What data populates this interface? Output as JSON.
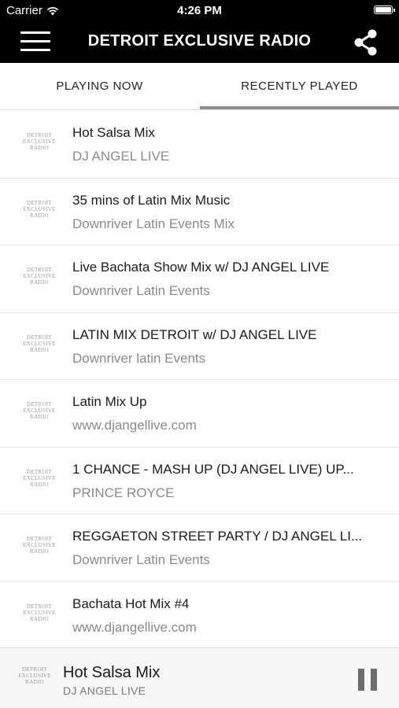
{
  "status_bar": {
    "carrier": "Carrier",
    "time": "4:26 PM"
  },
  "header": {
    "title": "DETROIT EXCLUSIVE RADIO",
    "menu_icon": "hamburger-menu-icon",
    "share_icon": "share-icon"
  },
  "tabs": [
    {
      "label": "PLAYING NOW",
      "selected": false
    },
    {
      "label": "RECENTLY PLAYED",
      "selected": true
    }
  ],
  "logo_text": [
    "DETROIT",
    "EXCLUSIVE",
    "RADIO"
  ],
  "tracks": [
    {
      "title": "Hot Salsa Mix",
      "artist": "DJ ANGEL LIVE"
    },
    {
      "title": "35 mins of Latin Mix Music",
      "artist": "Downriver Latin Events Mix"
    },
    {
      "title": "Live Bachata Show Mix w/ DJ ANGEL LIVE",
      "artist": "Downriver Latin Events"
    },
    {
      "title": "LATIN MIX DETROIT w/ DJ ANGEL LIVE",
      "artist": "Downriver latin Events"
    },
    {
      "title": "Latin Mix Up",
      "artist": "www.djangellive.com"
    },
    {
      "title": "1 CHANCE - MASH UP (DJ ANGEL LIVE) UP...",
      "artist": "PRINCE ROYCE"
    },
    {
      "title": "REGGAETON STREET PARTY / DJ ANGEL LI...",
      "artist": "Downriver Latin Events"
    },
    {
      "title": "Bachata Hot Mix #4",
      "artist": "www.djangellive.com"
    }
  ],
  "now_playing": {
    "title": "Hot Salsa Mix",
    "artist": "DJ ANGEL LIVE",
    "control_icon": "pause-icon"
  },
  "colors": {
    "header_bg": "#000000",
    "tab_indicator": "#8c8c8c",
    "subtitle": "#8a8a8a"
  }
}
